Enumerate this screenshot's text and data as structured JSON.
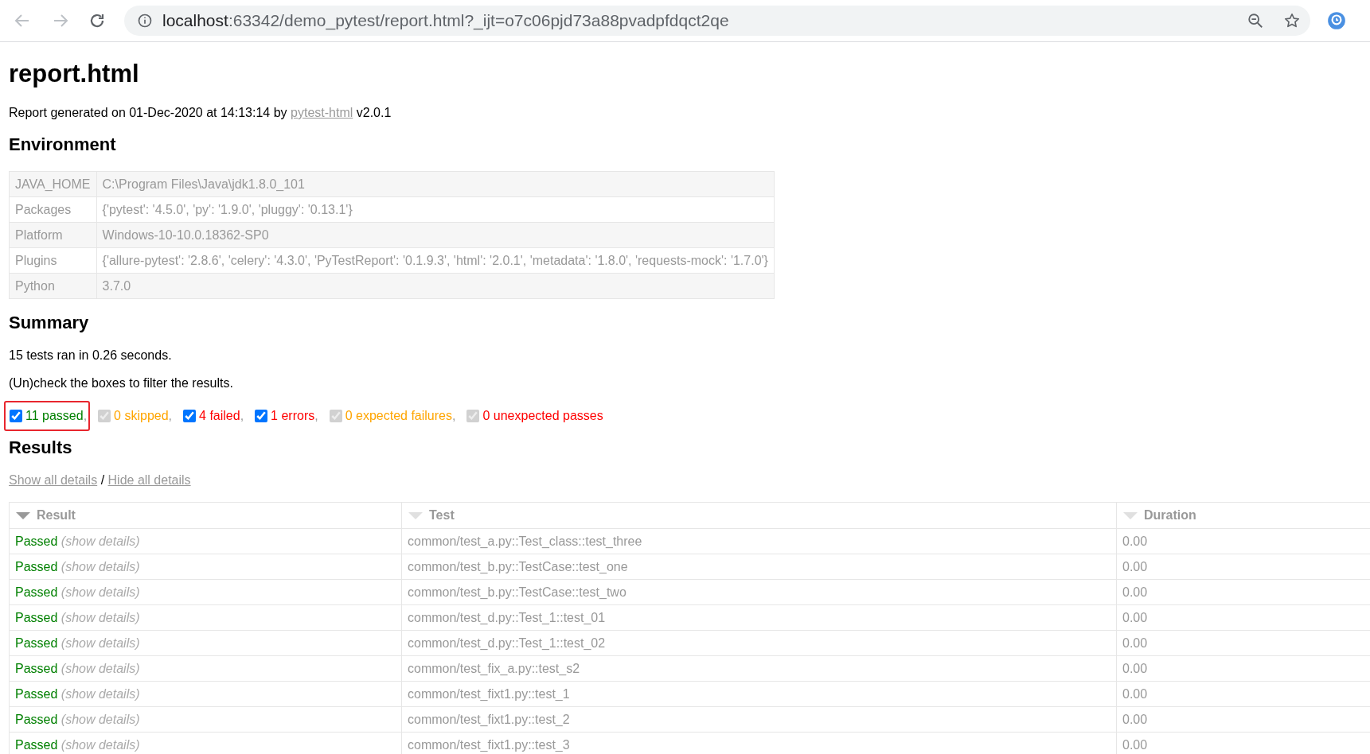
{
  "browser": {
    "url_host": "localhost",
    "url_rest": ":63342/demo_pytest/report.html?_ijt=o7c06pjd73a88pvadpfdqct2qe"
  },
  "title": "report.html",
  "generated": {
    "before": "Report generated on 01-Dec-2020 at 14:13:14 by",
    "link": "pytest-html",
    "after": "v2.0.1"
  },
  "environment": {
    "heading": "Environment",
    "rows": [
      {
        "key": "JAVA_HOME",
        "value": "C:\\Program Files\\Java\\jdk1.8.0_101"
      },
      {
        "key": "Packages",
        "value": "{'pytest': '4.5.0', 'py': '1.9.0', 'pluggy': '0.13.1'}"
      },
      {
        "key": "Platform",
        "value": "Windows-10-10.0.18362-SP0"
      },
      {
        "key": "Plugins",
        "value": "{'allure-pytest': '2.8.6', 'celery': '4.3.0', 'PyTestReport': '0.1.9.3', 'html': '2.0.1', 'metadata': '1.8.0', 'requests-mock': '1.7.0'}"
      },
      {
        "key": "Python",
        "value": "3.7.0"
      }
    ]
  },
  "summary": {
    "heading": "Summary",
    "ran": "15 tests ran in 0.26 seconds.",
    "hint": "(Un)check the boxes to filter the results.",
    "filters": [
      {
        "label": "11 passed",
        "separator": ",",
        "color": "#008000",
        "checked": true,
        "disabled": false,
        "highlighted": true
      },
      {
        "label": "0 skipped",
        "separator": ",",
        "color": "#ffa500",
        "checked": true,
        "disabled": true,
        "highlighted": false
      },
      {
        "label": "4 failed",
        "separator": ",",
        "color": "#ff0000",
        "checked": true,
        "disabled": false,
        "highlighted": false
      },
      {
        "label": "1 errors",
        "separator": ",",
        "color": "#ff0000",
        "checked": true,
        "disabled": false,
        "highlighted": false
      },
      {
        "label": "0 expected failures",
        "separator": ",",
        "color": "#ffa500",
        "checked": true,
        "disabled": true,
        "highlighted": false
      },
      {
        "label": "0 unexpected passes",
        "color": "#ff0000",
        "checked": true,
        "disabled": true,
        "highlighted": false
      }
    ]
  },
  "results": {
    "heading": "Results",
    "show_all": "Show all details",
    "divider": "/",
    "hide_all": "Hide all details",
    "columns": [
      {
        "label": "Result",
        "sorted": true
      },
      {
        "label": "Test",
        "sorted": false
      },
      {
        "label": "Duration",
        "sorted": false
      }
    ],
    "rows": [
      {
        "result": "Passed",
        "details": "(show details)",
        "test": "common/test_a.py::Test_class::test_three",
        "duration": "0.00"
      },
      {
        "result": "Passed",
        "details": "(show details)",
        "test": "common/test_b.py::TestCase::test_one",
        "duration": "0.00"
      },
      {
        "result": "Passed",
        "details": "(show details)",
        "test": "common/test_b.py::TestCase::test_two",
        "duration": "0.00"
      },
      {
        "result": "Passed",
        "details": "(show details)",
        "test": "common/test_d.py::Test_1::test_01",
        "duration": "0.00"
      },
      {
        "result": "Passed",
        "details": "(show details)",
        "test": "common/test_d.py::Test_1::test_02",
        "duration": "0.00"
      },
      {
        "result": "Passed",
        "details": "(show details)",
        "test": "common/test_fix_a.py::test_s2",
        "duration": "0.00"
      },
      {
        "result": "Passed",
        "details": "(show details)",
        "test": "common/test_fixt1.py::test_1",
        "duration": "0.00"
      },
      {
        "result": "Passed",
        "details": "(show details)",
        "test": "common/test_fixt1.py::test_2",
        "duration": "0.00"
      },
      {
        "result": "Passed",
        "details": "(show details)",
        "test": "common/test_fixt1.py::test_3",
        "duration": "0.00"
      }
    ]
  }
}
